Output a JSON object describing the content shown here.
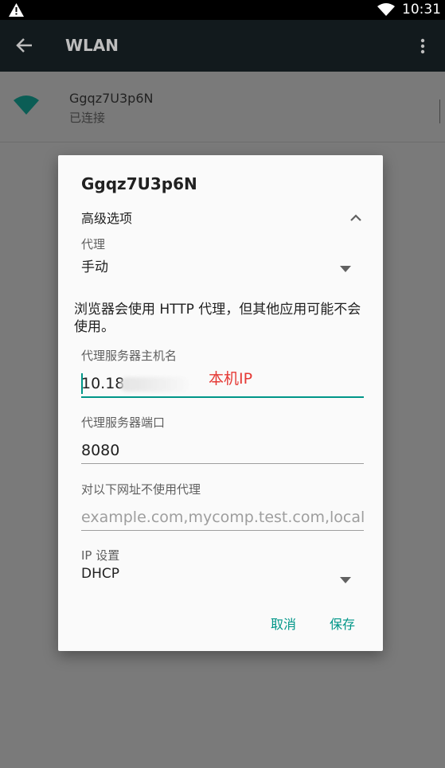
{
  "status_bar": {
    "time": "10:31",
    "icons": [
      "warning-icon",
      "wifi-icon",
      "battery-icon"
    ]
  },
  "app_bar": {
    "title": "WLAN",
    "icons": [
      "back-arrow-icon",
      "overflow-menu-icon"
    ]
  },
  "network": {
    "ssid": "Ggqz7U3p6N",
    "status": "已连接"
  },
  "dialog": {
    "title": "Ggqz7U3p6N",
    "advanced_label": "高级选项",
    "proxy_label": "代理",
    "proxy_value": "手动",
    "warning": "浏览器会使用 HTTP 代理，但其他应用可能不会使用。",
    "hostname_label": "代理服务器主机名",
    "hostname_value": "10.18",
    "annotation": "本机IP",
    "port_label": "代理服务器端口",
    "port_value": "8080",
    "bypass_label": "对以下网址不使用代理",
    "bypass_placeholder": "example.com,mycomp.test.com,localhost",
    "ip_label": "IP 设置",
    "ip_value": "DHCP",
    "cancel_label": "取消",
    "save_label": "保存"
  },
  "colors": {
    "accent": "#009688",
    "annotation": "#e53935",
    "scrim": "#7a7a7a"
  }
}
